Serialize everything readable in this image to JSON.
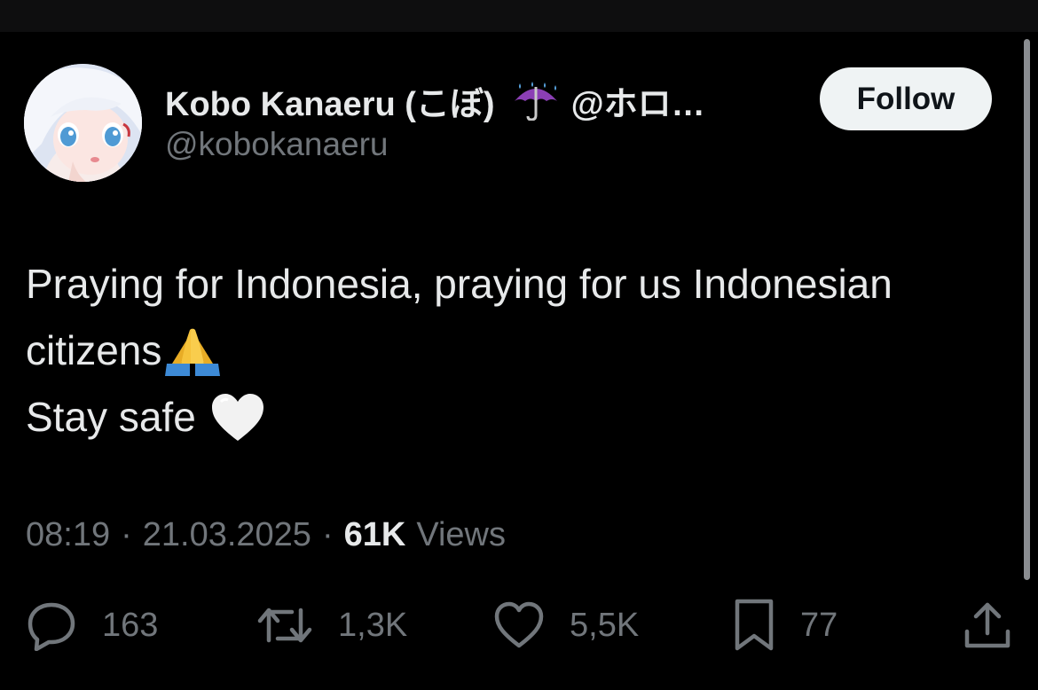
{
  "author": {
    "display_name": "Kobo Kanaeru (こぼ)",
    "name_emoji": "umbrella-with-rain-icon",
    "affiliation": "@ホロ…",
    "handle": "@kobokanaeru",
    "follow_label": "Follow"
  },
  "tweet": {
    "line1": "Praying for Indonesia, praying for us Indonesian",
    "line2": "citizens",
    "line2_emoji": "folded-hands-icon",
    "line3": "Stay safe",
    "line3_emoji": "white-heart-icon"
  },
  "meta": {
    "time": "08:19",
    "date": "21.03.2025",
    "views_count": "61K",
    "views_label": "Views"
  },
  "actions": {
    "replies": "163",
    "reposts": "1,3K",
    "likes": "5,5K",
    "bookmarks": "77"
  },
  "colors": {
    "background": "#000000",
    "primary_text": "#e7e9ea",
    "secondary_text": "#71767b",
    "follow_button_bg": "#eff3f4"
  }
}
